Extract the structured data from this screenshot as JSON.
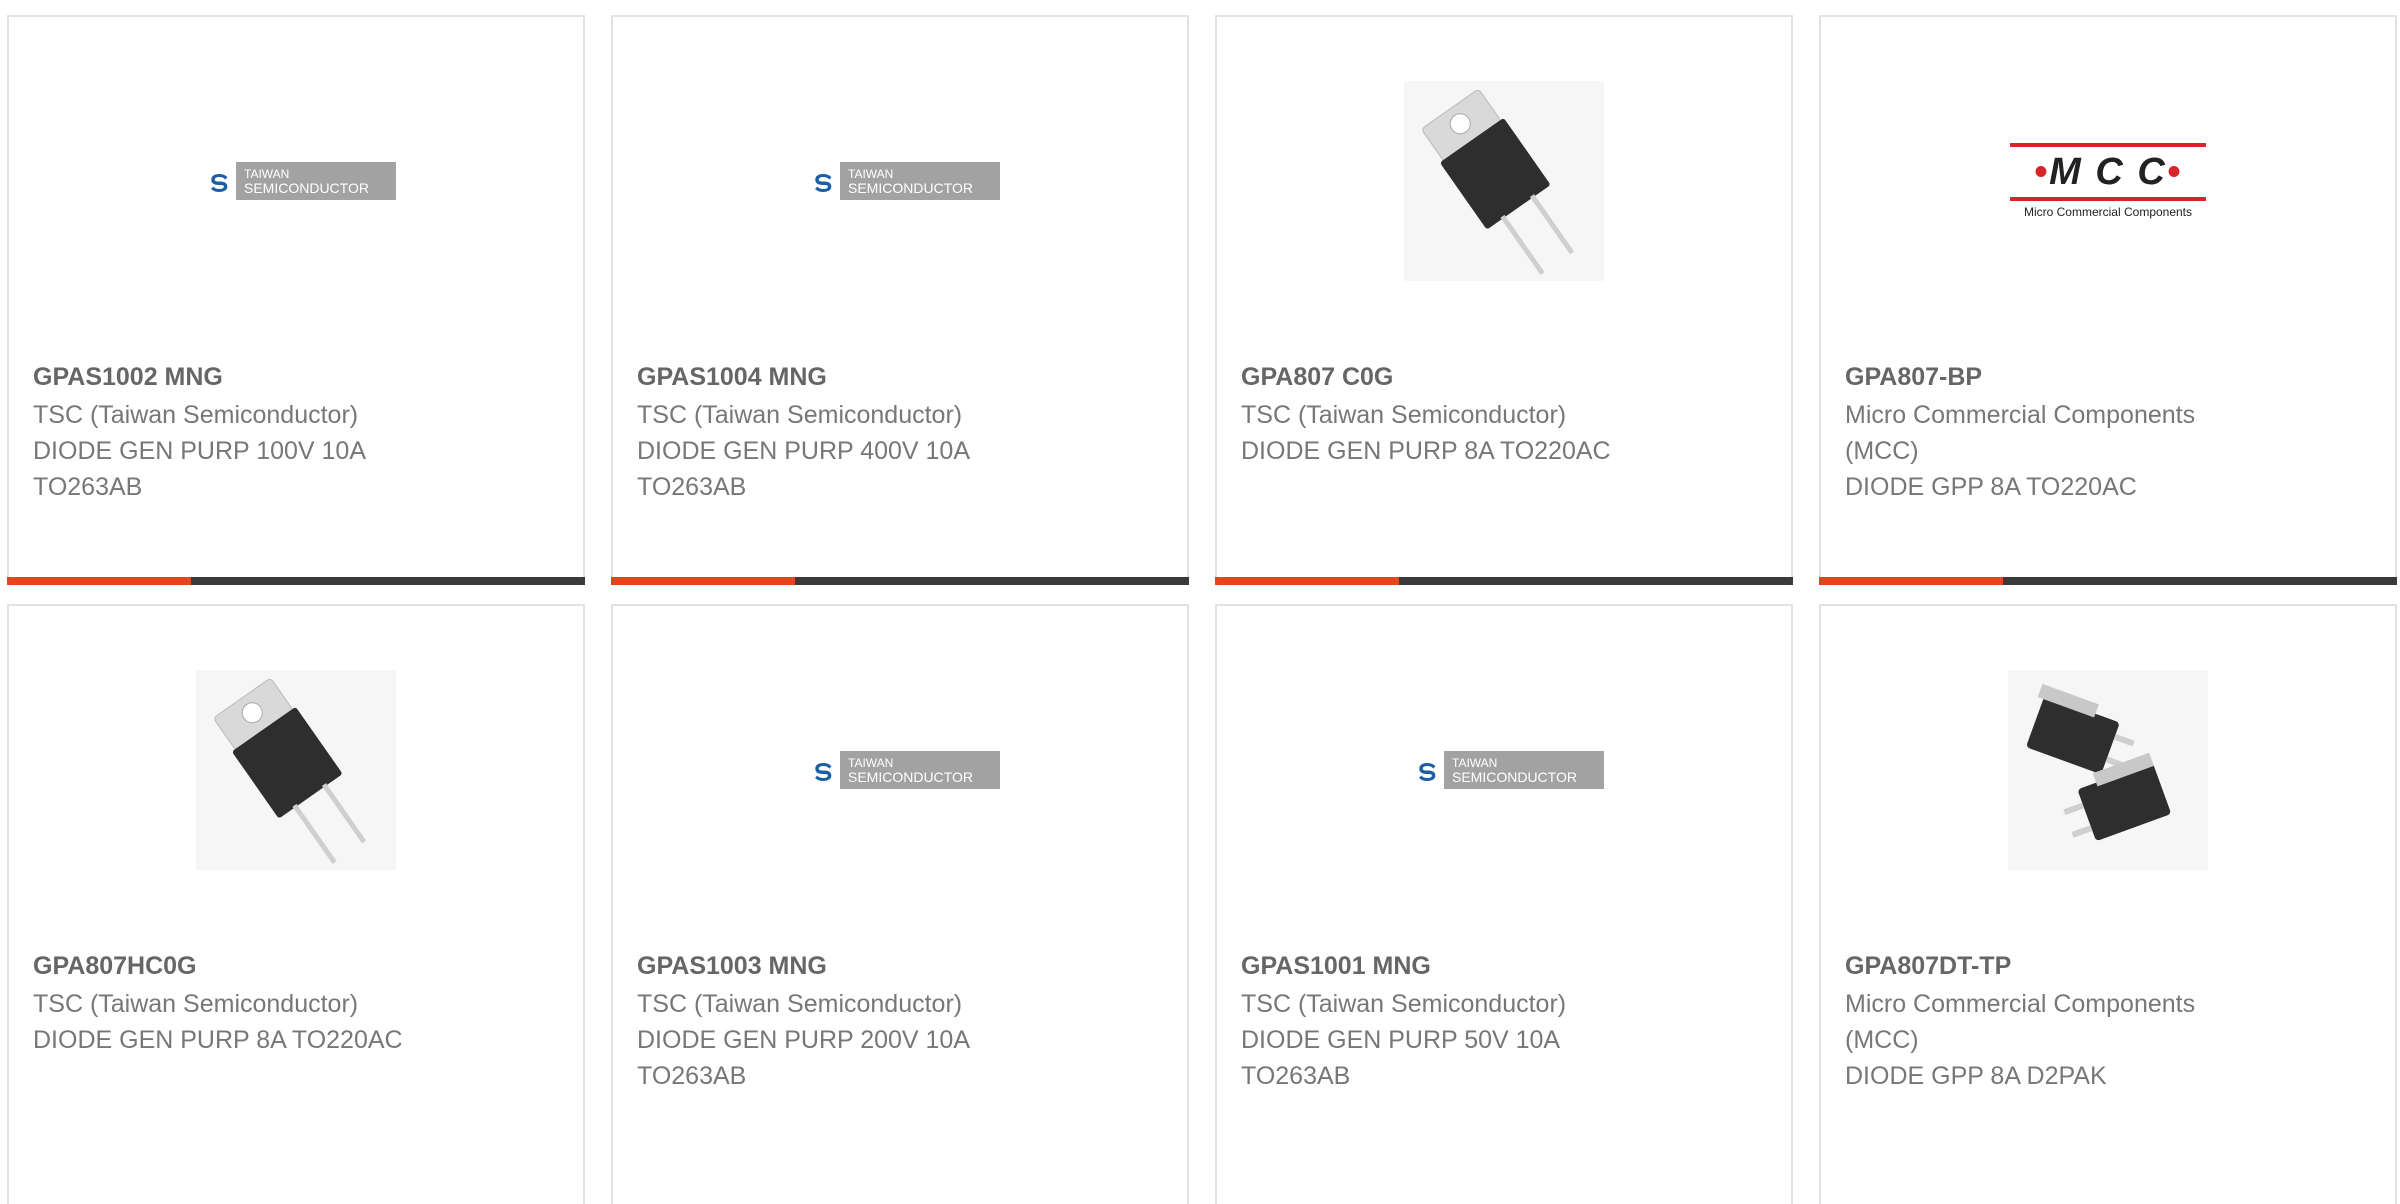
{
  "products": [
    {
      "part": "GPAS1002 MNG",
      "lines": [
        "TSC (Taiwan Semiconductor)",
        "DIODE GEN PURP 100V 10A",
        "TO263AB"
      ],
      "image": "tsc-logo"
    },
    {
      "part": "GPAS1004 MNG",
      "lines": [
        "TSC (Taiwan Semiconductor)",
        "DIODE GEN PURP 400V 10A",
        "TO263AB"
      ],
      "image": "tsc-logo"
    },
    {
      "part": "GPA807 C0G",
      "lines": [
        "TSC (Taiwan Semiconductor)",
        "DIODE GEN PURP 8A TO220AC"
      ],
      "image": "to220-package"
    },
    {
      "part": "GPA807-BP",
      "lines": [
        "Micro Commercial Components",
        "(MCC)",
        "DIODE GPP 8A TO220AC"
      ],
      "image": "mcc-logo"
    },
    {
      "part": "GPA807HC0G",
      "lines": [
        "TSC (Taiwan Semiconductor)",
        "DIODE GEN PURP 8A TO220AC"
      ],
      "image": "to220-package"
    },
    {
      "part": "GPAS1003 MNG",
      "lines": [
        "TSC (Taiwan Semiconductor)",
        "DIODE GEN PURP 200V 10A",
        "TO263AB"
      ],
      "image": "tsc-logo"
    },
    {
      "part": "GPAS1001 MNG",
      "lines": [
        "TSC (Taiwan Semiconductor)",
        "DIODE GEN PURP 50V 10A",
        "TO263AB"
      ],
      "image": "tsc-logo"
    },
    {
      "part": "GPA807DT-TP",
      "lines": [
        "Micro Commercial Components",
        "(MCC)",
        "DIODE GPP 8A D2PAK"
      ],
      "image": "d2pak-package"
    }
  ],
  "logos": {
    "tsc": {
      "line1": "TAIWAN",
      "line2": "SEMICONDUCTOR"
    },
    "mcc": {
      "big": "M C C",
      "small": "Micro Commercial Components"
    }
  },
  "colors": {
    "accent": "#e2461e",
    "bar": "#3a3a3a",
    "border": "#e3e3e3"
  }
}
